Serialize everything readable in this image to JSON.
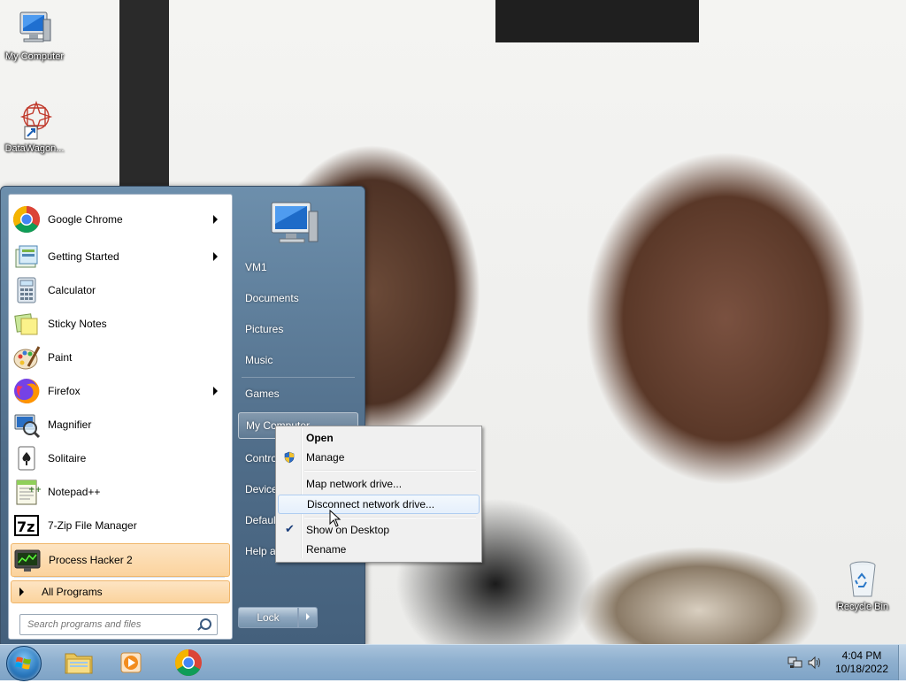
{
  "desktop": {
    "icons": [
      {
        "label": "My Computer",
        "icon": "computer-icon"
      },
      {
        "label": "DataWagon...",
        "icon": "datawagon-icon"
      },
      {
        "label": "Recycle Bin",
        "icon": "recycle-bin-icon"
      }
    ]
  },
  "start_menu": {
    "programs": [
      {
        "label": "Google Chrome",
        "icon": "chrome-icon",
        "has_submenu": true
      },
      {
        "label": "Getting Started",
        "icon": "getting-started-icon",
        "has_submenu": true
      },
      {
        "label": "Calculator",
        "icon": "calculator-icon",
        "has_submenu": false
      },
      {
        "label": "Sticky Notes",
        "icon": "sticky-notes-icon",
        "has_submenu": false
      },
      {
        "label": "Paint",
        "icon": "paint-icon",
        "has_submenu": false
      },
      {
        "label": "Firefox",
        "icon": "firefox-icon",
        "has_submenu": true
      },
      {
        "label": "Magnifier",
        "icon": "magnifier-icon",
        "has_submenu": false
      },
      {
        "label": "Solitaire",
        "icon": "solitaire-icon",
        "has_submenu": false
      },
      {
        "label": "Notepad++",
        "icon": "notepadpp-icon",
        "has_submenu": false
      },
      {
        "label": "7-Zip File Manager",
        "icon": "7zip-icon",
        "has_submenu": false
      },
      {
        "label": "Process Hacker 2",
        "icon": "process-hacker-icon",
        "has_submenu": false,
        "highlighted": true
      }
    ],
    "all_programs_label": "All Programs",
    "search_placeholder": "Search programs and files",
    "right_items": [
      {
        "label": "VM1"
      },
      {
        "label": "Documents"
      },
      {
        "label": "Pictures"
      },
      {
        "label": "Music"
      },
      {
        "label": "Games"
      },
      {
        "label": "My Computer",
        "highlighted": true
      },
      {
        "label": "Control Panel"
      },
      {
        "label": "Devices and Printers"
      },
      {
        "label": "Default Programs"
      },
      {
        "label": "Help and Support"
      }
    ],
    "lock_label": "Lock"
  },
  "context_menu": {
    "items": [
      {
        "label": "Open",
        "bold": true
      },
      {
        "label": "Manage",
        "icon": "uac-shield-icon"
      },
      {
        "label": "Map network drive..."
      },
      {
        "label": "Disconnect network drive...",
        "highlighted": true
      },
      {
        "label": "Show on Desktop",
        "checked": true
      },
      {
        "label": "Rename"
      }
    ]
  },
  "taskbar": {
    "pinned": [
      {
        "name": "windows-explorer",
        "icon": "folder-icon"
      },
      {
        "name": "media-player",
        "icon": "media-player-icon"
      },
      {
        "name": "google-chrome",
        "icon": "chrome-icon"
      }
    ],
    "clock": {
      "time": "4:04 PM",
      "date": "10/18/2022"
    }
  }
}
